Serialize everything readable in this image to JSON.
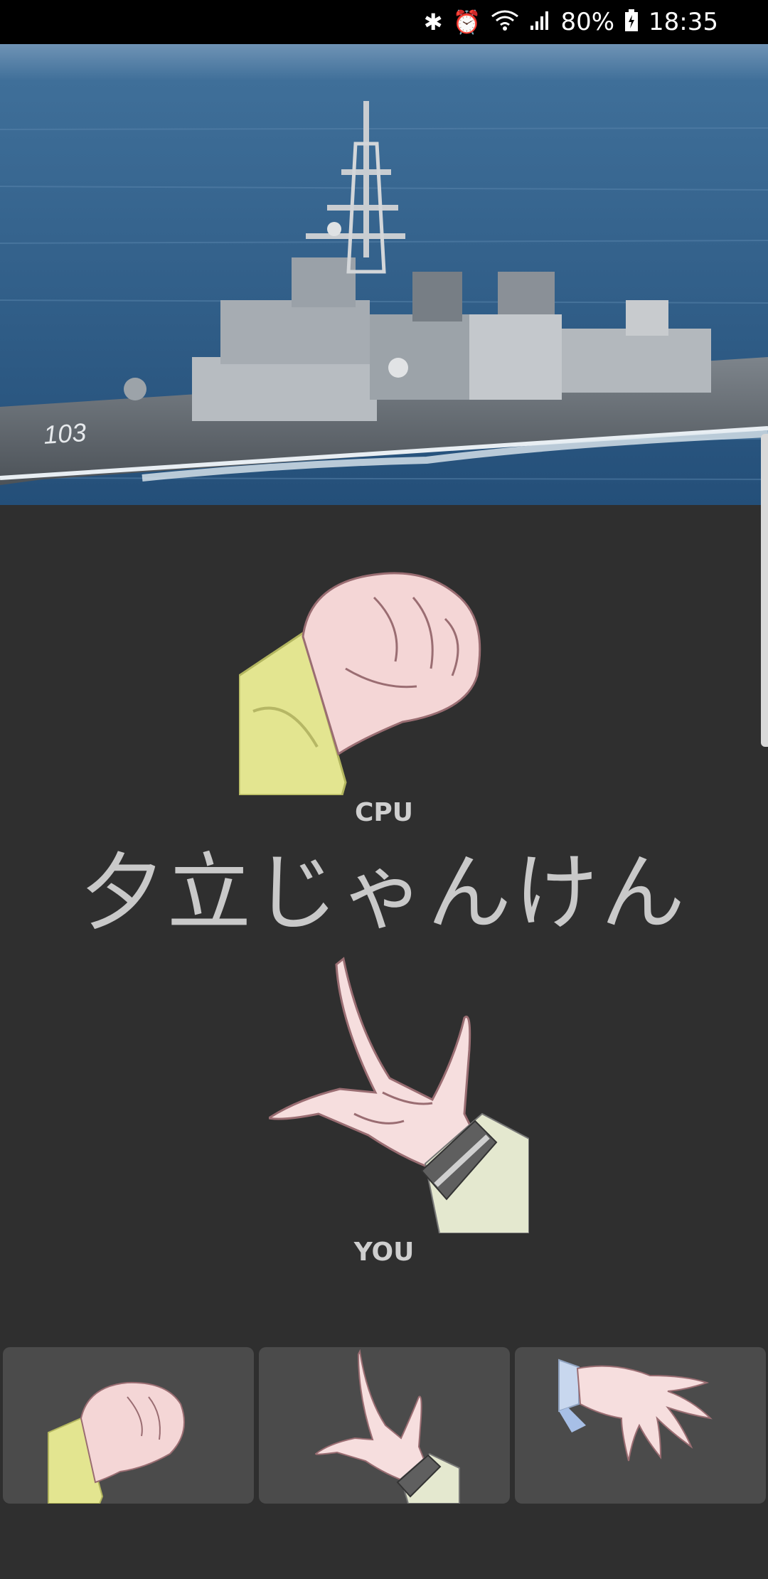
{
  "status_bar": {
    "battery": "80%",
    "time": "18:35",
    "icons": [
      "bluetooth-icon",
      "alarm-icon",
      "wifi-icon",
      "signal-icon",
      "battery-icon"
    ]
  },
  "hero": {
    "hull_number": "103"
  },
  "game": {
    "cpu_label": "CPU",
    "title": "夕立じゃんけん",
    "you_label": "YOU",
    "cpu_hand": "rock",
    "player_hand": "scissors"
  },
  "choices": [
    {
      "name": "rock"
    },
    {
      "name": "scissors"
    },
    {
      "name": "paper"
    }
  ],
  "colors": {
    "background": "#2f2f2f",
    "button": "#4b4b4b",
    "text": "#c9c9c9"
  }
}
